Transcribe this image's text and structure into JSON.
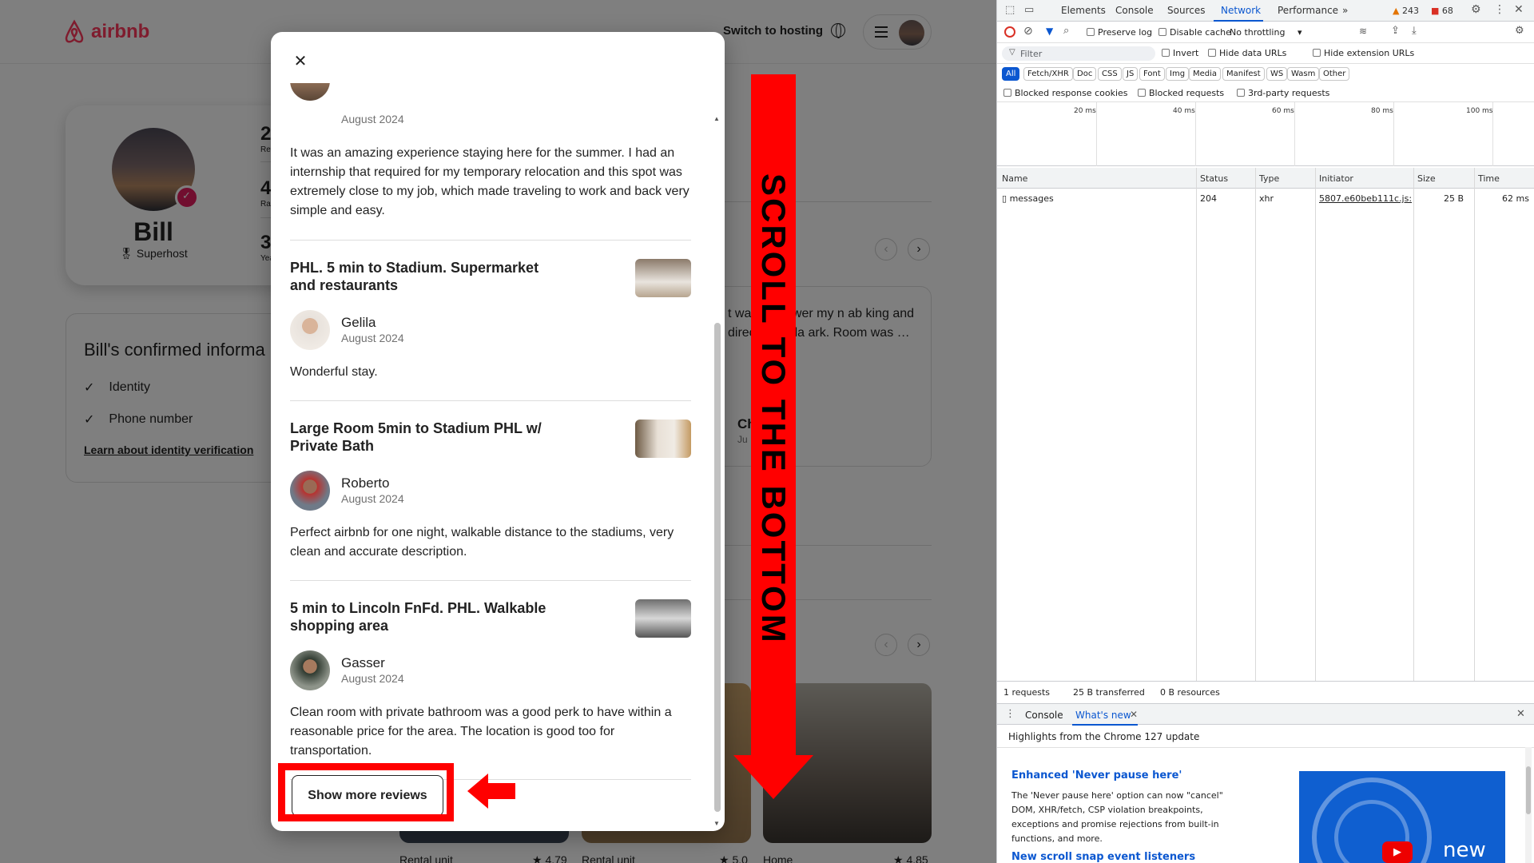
{
  "airbnb": {
    "logo_text": "airbnb",
    "nav": {
      "switch_to_hosting": "Switch to hosting"
    },
    "profile": {
      "name": "Bill",
      "badge": "Superhost",
      "stats": [
        {
          "value": "2",
          "label": "Rev"
        },
        {
          "value": "4",
          "label": "Rati"
        },
        {
          "value": "3",
          "label": "Yea"
        }
      ]
    },
    "confirmed": {
      "title": "Bill's confirmed informa",
      "items": [
        "Identity",
        "Phone number"
      ],
      "link": "Learn about identity verification"
    },
    "background_review": {
      "text": "t was  o answer my n ab  king and directed a pla  ark. Room was …",
      "name_fragment": "Ch",
      "date_fragment": "Ju"
    },
    "listings": [
      {
        "type": "Rental unit",
        "rating": "★ 4.79"
      },
      {
        "type": "Rental unit",
        "rating": "★ 5.0"
      },
      {
        "type": "Home",
        "rating": "★ 4.85"
      }
    ]
  },
  "modal": {
    "first_review": {
      "date": "August 2024",
      "text": "It was an amazing experience staying here for the summer. I had an internship that required for my temporary relocation and this spot was extremely close to my job, which made traveling to work and back very simple and easy."
    },
    "reviews": [
      {
        "listing": "PHL. 5 min to Stadium. Supermarket and restaurants",
        "reviewer": "Gelila",
        "date": "August 2024",
        "text": "Wonderful stay."
      },
      {
        "listing": "Large Room 5min to Stadium PHL w/ Private Bath",
        "reviewer": "Roberto",
        "date": "August 2024",
        "text": "Perfect airbnb for one night, walkable distance to the stadiums, very clean and accurate description."
      },
      {
        "listing": "5 min to Lincoln FnFd. PHL. Walkable shopping area",
        "reviewer": "Gasser",
        "date": "August 2024",
        "text": "Clean room with private bathroom was a good perk to have within a reasonable price for the area. The location is good too for transportation."
      }
    ],
    "show_more": "Show more reviews"
  },
  "annotation": {
    "label": "SCROLL TO THE BOTTOM",
    "color": "#ff0000"
  },
  "devtools": {
    "tabs": [
      "Elements",
      "Console",
      "Sources",
      "Network",
      "Performance"
    ],
    "active_tab": "Network",
    "warnings": "243",
    "errors": "68",
    "toolbar": {
      "preserve_log": "Preserve log",
      "disable_cache": "Disable cache",
      "throttling": "No throttling"
    },
    "filter": {
      "placeholder": "Filter",
      "invert": "Invert",
      "hide_data_urls": "Hide data URLs",
      "hide_extension_urls": "Hide extension URLs"
    },
    "types": [
      "All",
      "Fetch/XHR",
      "Doc",
      "CSS",
      "JS",
      "Font",
      "Img",
      "Media",
      "Manifest",
      "WS",
      "Wasm",
      "Other"
    ],
    "blocked": {
      "cookies": "Blocked response cookies",
      "requests": "Blocked requests",
      "third_party": "3rd-party requests"
    },
    "timeline_ticks": [
      "20 ms",
      "40 ms",
      "60 ms",
      "80 ms",
      "100 ms"
    ],
    "columns": [
      "Name",
      "Status",
      "Type",
      "Initiator",
      "Size",
      "Time"
    ],
    "rows": [
      {
        "name": "messages",
        "status": "204",
        "type": "xhr",
        "initiator": "5807.e60beb111c.js:s",
        "size": "25 B",
        "time": "62 ms"
      }
    ],
    "status_bar": {
      "requests": "1 requests",
      "transferred": "25 B transferred",
      "resources": "0 B resources"
    },
    "drawer": {
      "tabs": [
        "Console",
        "What's new"
      ],
      "headline": "Highlights from the Chrome 127 update",
      "item1_title": "Enhanced 'Never pause here'",
      "item1_text": "The 'Never pause here' option can now \"cancel\" DOM, XHR/fetch, CSP violation breakpoints, exceptions and promise rejections from built-in functions, and more.",
      "item2_title": "New scroll snap event listeners",
      "promo_word": "new"
    }
  }
}
